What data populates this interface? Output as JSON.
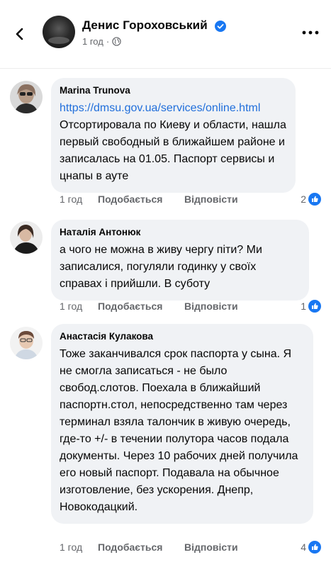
{
  "header": {
    "author_name": "Денис Гороховський",
    "time": "1 год",
    "separator": "·"
  },
  "comments": [
    {
      "author": "Marina Trunova",
      "link": "https://dmsu.gov.ua/services/online.html",
      "text": "Отсортировала по Киеву  и области, нашла  первый свободный в ближайшем районе и записалась на 01.05. Паспорт сервисы  и цнапы в ауте",
      "time": "1 год",
      "like_label": "Подобається",
      "reply_label": "Відповісти",
      "reactions": "2"
    },
    {
      "author": "Наталія Антонюк",
      "text": "а чого не можна в живу чергу піти? Ми записалися, погуляли годинку у своїх справах і прийшли. В суботу",
      "time": "1 год",
      "like_label": "Подобається",
      "reply_label": "Відповісти",
      "reactions": "1"
    },
    {
      "author": "Анастасія Кулакова",
      "text": "Тоже заканчивался срок паспорта у сына. Я не смогла записаться - не было свобод.слотов. Поехала в ближайший паспортн.стол, непосредственно там через терминал взяла талончик в живую очередь, где-то +/- в течении полутора часов подала документы. Через 10 рабочих дней получила его новый паспорт. Подавала на обычное изготовление, без ускорения. Днепр, Новокодацкий.",
      "time": "1 год",
      "like_label": "Подобається",
      "reply_label": "Відповісти",
      "reactions": "4"
    }
  ],
  "icons": {
    "back": "back-arrow-icon",
    "verified": "verified-badge-icon",
    "privacy": "globe-icon",
    "more": "more-options-icon",
    "reaction": "like-reaction-icon"
  },
  "colors": {
    "accent": "#1877f2",
    "link": "#216fdb",
    "bubble": "#f0f2f5",
    "secondary_text": "#65676b"
  }
}
